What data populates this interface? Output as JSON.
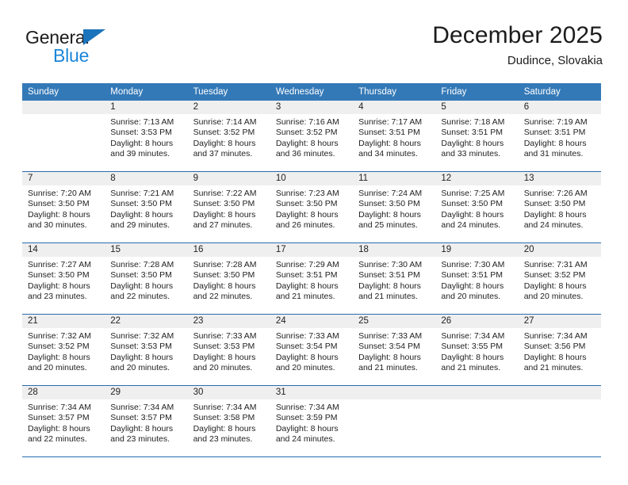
{
  "brand": {
    "name_top": "General",
    "name_bottom": "Blue",
    "accent_color": "#1a86d8",
    "triangle_color": "#1a74bb"
  },
  "header": {
    "title": "December 2025",
    "location": "Dudince, Slovakia"
  },
  "calendar": {
    "header_bg": "#3479b7",
    "row_rule_color": "#2a6db0",
    "daynum_bg": "#efefef",
    "weekday_headers": [
      "Sunday",
      "Monday",
      "Tuesday",
      "Wednesday",
      "Thursday",
      "Friday",
      "Saturday"
    ],
    "weeks": [
      [
        {
          "day": ""
        },
        {
          "day": "1",
          "sunrise": "Sunrise: 7:13 AM",
          "sunset": "Sunset: 3:53 PM",
          "daylight_1": "Daylight: 8 hours",
          "daylight_2": "and 39 minutes."
        },
        {
          "day": "2",
          "sunrise": "Sunrise: 7:14 AM",
          "sunset": "Sunset: 3:52 PM",
          "daylight_1": "Daylight: 8 hours",
          "daylight_2": "and 37 minutes."
        },
        {
          "day": "3",
          "sunrise": "Sunrise: 7:16 AM",
          "sunset": "Sunset: 3:52 PM",
          "daylight_1": "Daylight: 8 hours",
          "daylight_2": "and 36 minutes."
        },
        {
          "day": "4",
          "sunrise": "Sunrise: 7:17 AM",
          "sunset": "Sunset: 3:51 PM",
          "daylight_1": "Daylight: 8 hours",
          "daylight_2": "and 34 minutes."
        },
        {
          "day": "5",
          "sunrise": "Sunrise: 7:18 AM",
          "sunset": "Sunset: 3:51 PM",
          "daylight_1": "Daylight: 8 hours",
          "daylight_2": "and 33 minutes."
        },
        {
          "day": "6",
          "sunrise": "Sunrise: 7:19 AM",
          "sunset": "Sunset: 3:51 PM",
          "daylight_1": "Daylight: 8 hours",
          "daylight_2": "and 31 minutes."
        }
      ],
      [
        {
          "day": "7",
          "sunrise": "Sunrise: 7:20 AM",
          "sunset": "Sunset: 3:50 PM",
          "daylight_1": "Daylight: 8 hours",
          "daylight_2": "and 30 minutes."
        },
        {
          "day": "8",
          "sunrise": "Sunrise: 7:21 AM",
          "sunset": "Sunset: 3:50 PM",
          "daylight_1": "Daylight: 8 hours",
          "daylight_2": "and 29 minutes."
        },
        {
          "day": "9",
          "sunrise": "Sunrise: 7:22 AM",
          "sunset": "Sunset: 3:50 PM",
          "daylight_1": "Daylight: 8 hours",
          "daylight_2": "and 27 minutes."
        },
        {
          "day": "10",
          "sunrise": "Sunrise: 7:23 AM",
          "sunset": "Sunset: 3:50 PM",
          "daylight_1": "Daylight: 8 hours",
          "daylight_2": "and 26 minutes."
        },
        {
          "day": "11",
          "sunrise": "Sunrise: 7:24 AM",
          "sunset": "Sunset: 3:50 PM",
          "daylight_1": "Daylight: 8 hours",
          "daylight_2": "and 25 minutes."
        },
        {
          "day": "12",
          "sunrise": "Sunrise: 7:25 AM",
          "sunset": "Sunset: 3:50 PM",
          "daylight_1": "Daylight: 8 hours",
          "daylight_2": "and 24 minutes."
        },
        {
          "day": "13",
          "sunrise": "Sunrise: 7:26 AM",
          "sunset": "Sunset: 3:50 PM",
          "daylight_1": "Daylight: 8 hours",
          "daylight_2": "and 24 minutes."
        }
      ],
      [
        {
          "day": "14",
          "sunrise": "Sunrise: 7:27 AM",
          "sunset": "Sunset: 3:50 PM",
          "daylight_1": "Daylight: 8 hours",
          "daylight_2": "and 23 minutes."
        },
        {
          "day": "15",
          "sunrise": "Sunrise: 7:28 AM",
          "sunset": "Sunset: 3:50 PM",
          "daylight_1": "Daylight: 8 hours",
          "daylight_2": "and 22 minutes."
        },
        {
          "day": "16",
          "sunrise": "Sunrise: 7:28 AM",
          "sunset": "Sunset: 3:50 PM",
          "daylight_1": "Daylight: 8 hours",
          "daylight_2": "and 22 minutes."
        },
        {
          "day": "17",
          "sunrise": "Sunrise: 7:29 AM",
          "sunset": "Sunset: 3:51 PM",
          "daylight_1": "Daylight: 8 hours",
          "daylight_2": "and 21 minutes."
        },
        {
          "day": "18",
          "sunrise": "Sunrise: 7:30 AM",
          "sunset": "Sunset: 3:51 PM",
          "daylight_1": "Daylight: 8 hours",
          "daylight_2": "and 21 minutes."
        },
        {
          "day": "19",
          "sunrise": "Sunrise: 7:30 AM",
          "sunset": "Sunset: 3:51 PM",
          "daylight_1": "Daylight: 8 hours",
          "daylight_2": "and 20 minutes."
        },
        {
          "day": "20",
          "sunrise": "Sunrise: 7:31 AM",
          "sunset": "Sunset: 3:52 PM",
          "daylight_1": "Daylight: 8 hours",
          "daylight_2": "and 20 minutes."
        }
      ],
      [
        {
          "day": "21",
          "sunrise": "Sunrise: 7:32 AM",
          "sunset": "Sunset: 3:52 PM",
          "daylight_1": "Daylight: 8 hours",
          "daylight_2": "and 20 minutes."
        },
        {
          "day": "22",
          "sunrise": "Sunrise: 7:32 AM",
          "sunset": "Sunset: 3:53 PM",
          "daylight_1": "Daylight: 8 hours",
          "daylight_2": "and 20 minutes."
        },
        {
          "day": "23",
          "sunrise": "Sunrise: 7:33 AM",
          "sunset": "Sunset: 3:53 PM",
          "daylight_1": "Daylight: 8 hours",
          "daylight_2": "and 20 minutes."
        },
        {
          "day": "24",
          "sunrise": "Sunrise: 7:33 AM",
          "sunset": "Sunset: 3:54 PM",
          "daylight_1": "Daylight: 8 hours",
          "daylight_2": "and 20 minutes."
        },
        {
          "day": "25",
          "sunrise": "Sunrise: 7:33 AM",
          "sunset": "Sunset: 3:54 PM",
          "daylight_1": "Daylight: 8 hours",
          "daylight_2": "and 21 minutes."
        },
        {
          "day": "26",
          "sunrise": "Sunrise: 7:34 AM",
          "sunset": "Sunset: 3:55 PM",
          "daylight_1": "Daylight: 8 hours",
          "daylight_2": "and 21 minutes."
        },
        {
          "day": "27",
          "sunrise": "Sunrise: 7:34 AM",
          "sunset": "Sunset: 3:56 PM",
          "daylight_1": "Daylight: 8 hours",
          "daylight_2": "and 21 minutes."
        }
      ],
      [
        {
          "day": "28",
          "sunrise": "Sunrise: 7:34 AM",
          "sunset": "Sunset: 3:57 PM",
          "daylight_1": "Daylight: 8 hours",
          "daylight_2": "and 22 minutes."
        },
        {
          "day": "29",
          "sunrise": "Sunrise: 7:34 AM",
          "sunset": "Sunset: 3:57 PM",
          "daylight_1": "Daylight: 8 hours",
          "daylight_2": "and 23 minutes."
        },
        {
          "day": "30",
          "sunrise": "Sunrise: 7:34 AM",
          "sunset": "Sunset: 3:58 PM",
          "daylight_1": "Daylight: 8 hours",
          "daylight_2": "and 23 minutes."
        },
        {
          "day": "31",
          "sunrise": "Sunrise: 7:34 AM",
          "sunset": "Sunset: 3:59 PM",
          "daylight_1": "Daylight: 8 hours",
          "daylight_2": "and 24 minutes."
        },
        {
          "day": ""
        },
        {
          "day": ""
        },
        {
          "day": ""
        }
      ]
    ]
  }
}
